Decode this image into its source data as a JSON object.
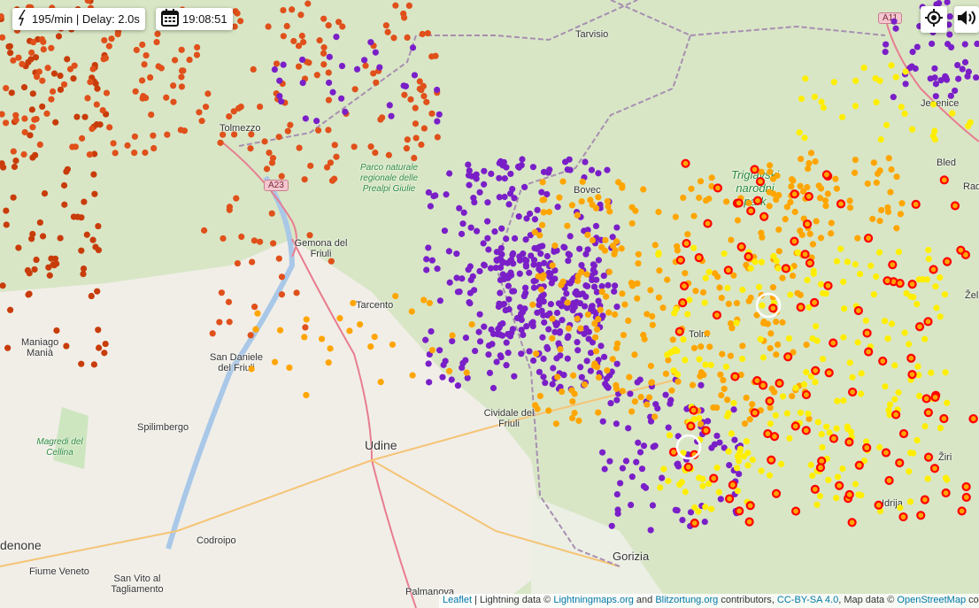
{
  "status": {
    "rate": "195/min | Delay: 2.0s",
    "time": "19:08:51"
  },
  "controls": {
    "locate": "locate-icon",
    "sound": "sound-icon"
  },
  "places": [
    "Tarvisio",
    "Jesenice",
    "Tolmezzo",
    "Bovec",
    "Bled",
    "Gemona del Friuli",
    "Tarcento",
    "Maniago",
    "Manià",
    "San Daniele del Friuli",
    "Spilimbergo",
    "Udine",
    "Cividale del Friuli",
    "Codroipo",
    "denone",
    "Fiume Veneto",
    "San Vito al Tagliamento",
    "Palmanova",
    "Gorizia",
    "Idrija",
    "Žiri",
    "Tolm",
    "Rad",
    "Žel"
  ],
  "parks": [
    "Parco naturale regionale delle Prealpi Giulie",
    "Triglavski narodni park",
    "Magredi del Cellina"
  ],
  "roads": [
    "A23",
    "A11"
  ],
  "attribution": {
    "leaflet": "Leaflet",
    "t1": " | Lightning data © ",
    "lm": "Lightningmaps.org",
    "t2": " and ",
    "bo": "Blitzortung.org",
    "t3": " contributors, ",
    "cc": "CC-BY-SA 4.0",
    "t4": ", Map data © ",
    "osm": "OpenStreetMap",
    "t5": " contri"
  },
  "strike_colors": {
    "oldest": "#c83c0a",
    "old": "#e0501a",
    "mid_old": "#7a1fc8",
    "mid": "#ffa500",
    "recent": "#ffee00",
    "newest": "#ff0000"
  }
}
